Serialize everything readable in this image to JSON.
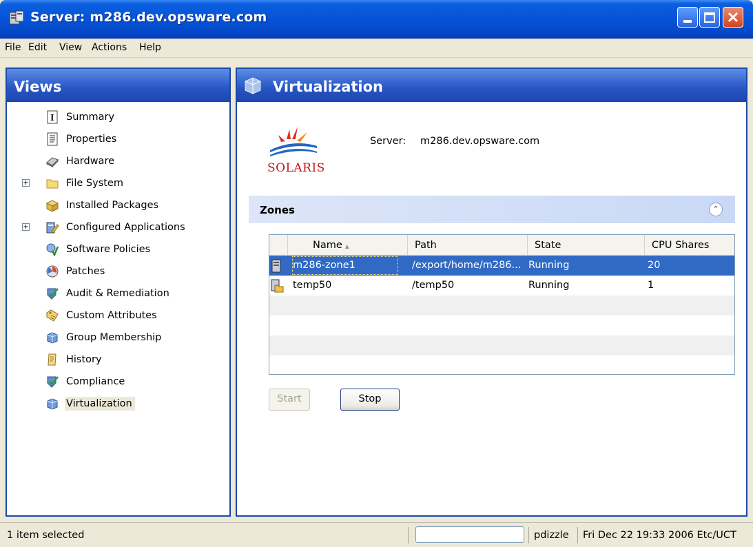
{
  "window": {
    "title": "Server: m286.dev.opsware.com",
    "colors": {
      "titlebar": "#0653D6",
      "close": "#D2441F"
    }
  },
  "menu": [
    "File",
    "Edit",
    "View",
    "Actions",
    "Help"
  ],
  "views_panel": {
    "title": "Views",
    "items": [
      {
        "label": "Summary",
        "icon": "summary-icon",
        "expandable": false
      },
      {
        "label": "Properties",
        "icon": "properties-icon",
        "expandable": false
      },
      {
        "label": "Hardware",
        "icon": "hardware-icon",
        "expandable": false
      },
      {
        "label": "File System",
        "icon": "folder-icon",
        "expandable": true
      },
      {
        "label": "Installed Packages",
        "icon": "package-icon",
        "expandable": false
      },
      {
        "label": "Configured Applications",
        "icon": "application-icon",
        "expandable": true
      },
      {
        "label": "Software Policies",
        "icon": "policy-icon",
        "expandable": false
      },
      {
        "label": "Patches",
        "icon": "patch-icon",
        "expandable": false
      },
      {
        "label": "Audit & Remediation",
        "icon": "audit-icon",
        "expandable": false
      },
      {
        "label": "Custom Attributes",
        "icon": "attributes-icon",
        "expandable": false
      },
      {
        "label": "Group Membership",
        "icon": "group-icon",
        "expandable": false
      },
      {
        "label": "History",
        "icon": "history-icon",
        "expandable": false
      },
      {
        "label": "Compliance",
        "icon": "compliance-icon",
        "expandable": false
      },
      {
        "label": "Virtualization",
        "icon": "virtualization-icon",
        "expandable": false,
        "selected": true
      }
    ]
  },
  "content": {
    "title": "Virtualization",
    "logo_text": "SOLARIS",
    "server_label": "Server:",
    "server_value": "m286.dev.opsware.com",
    "zones": {
      "title": "Zones",
      "columns": [
        "Name",
        "Path",
        "State",
        "CPU Shares"
      ],
      "rows": [
        {
          "name": "m286-zone1",
          "path": "/export/home/m286...",
          "state": "Running",
          "cpu_shares": "20",
          "selected": true
        },
        {
          "name": "temp50",
          "path": "/temp50",
          "state": "Running",
          "cpu_shares": "1",
          "selected": false
        }
      ]
    },
    "buttons": {
      "start": "Start",
      "stop": "Stop"
    }
  },
  "status": {
    "selection": "1 item selected",
    "user": "pdizzle",
    "datetime": "Fri Dec 22 19:33 2006 Etc/UCT"
  }
}
